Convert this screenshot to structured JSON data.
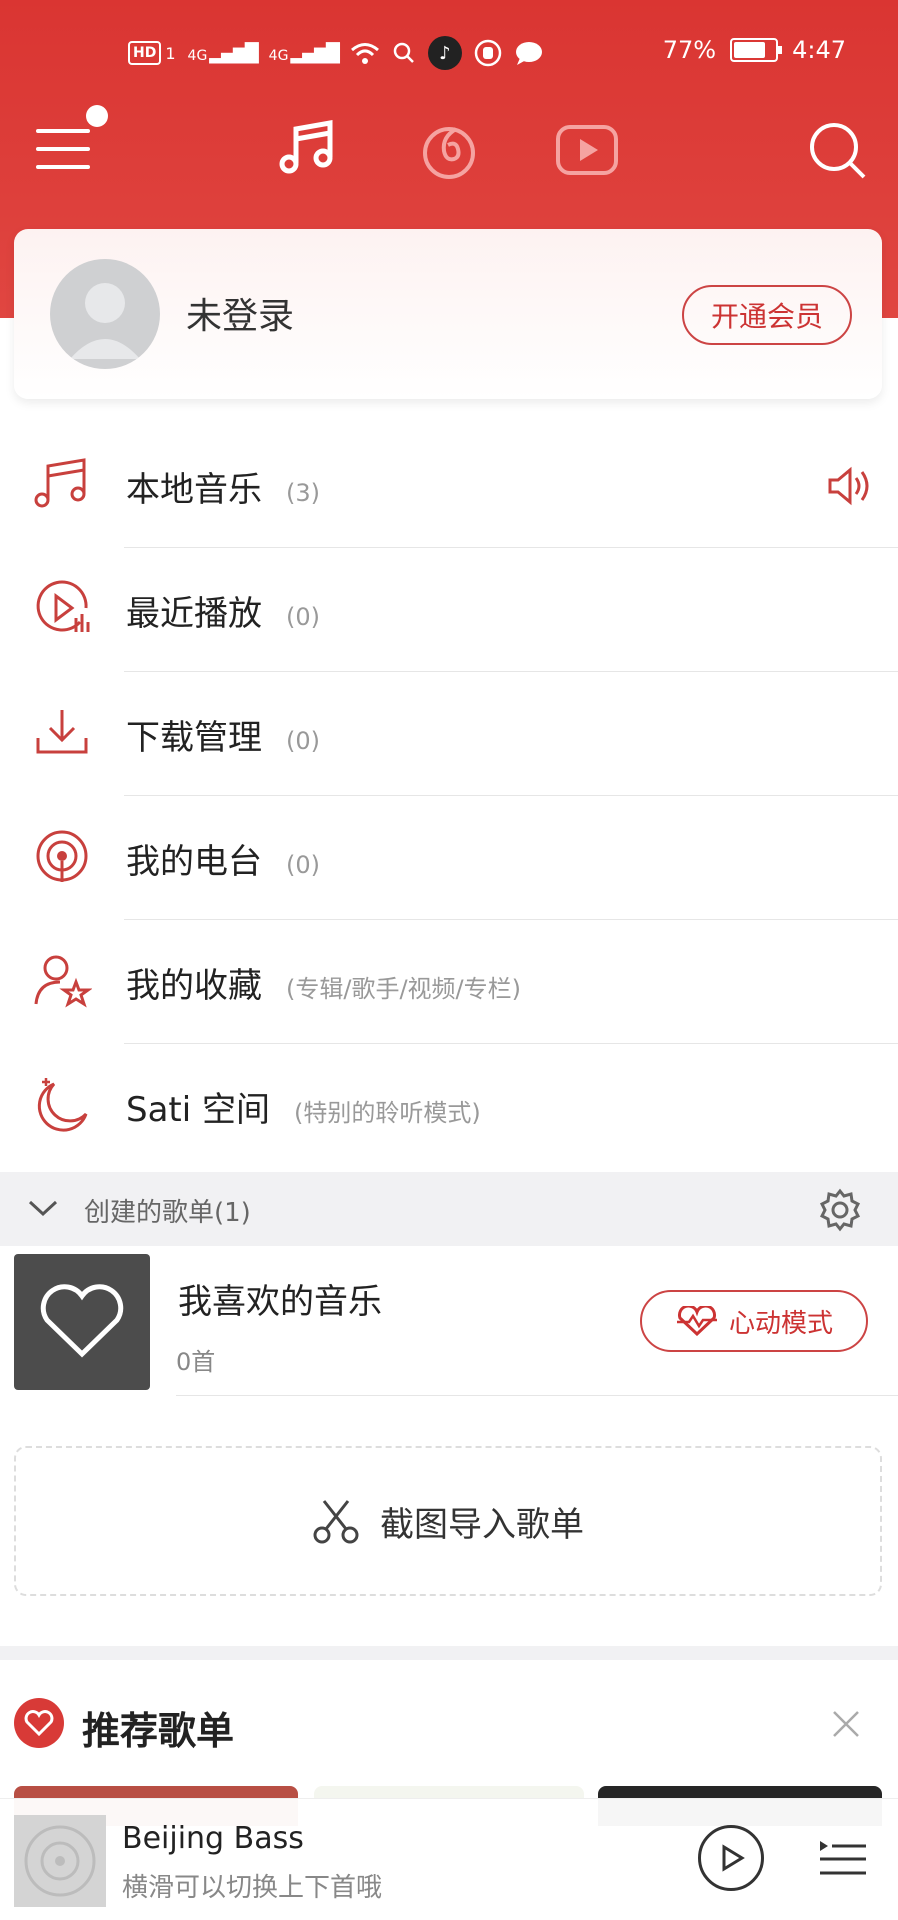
{
  "status_bar": {
    "left_badge": "HD",
    "left_badge_sub": "1",
    "network_1": "4G",
    "network_2": "4G",
    "battery_percent": "77%",
    "battery_level": 0.77,
    "time": "4:47"
  },
  "top_nav": {
    "menu_has_notification": true,
    "active_tab": "music-note-icon",
    "icons": [
      "menu-icon",
      "music-note-icon",
      "radio-loop-icon",
      "video-play-icon",
      "search-icon"
    ]
  },
  "profile_card": {
    "login_text": "未登录",
    "vip_button": "开通会员"
  },
  "menu_items": [
    {
      "label": "本地音乐",
      "count": "(3)",
      "icon": "music-note-icon"
    },
    {
      "label": "最近播放",
      "count": "(0)",
      "icon": "recent-play-icon"
    },
    {
      "label": "下载管理",
      "count": "(0)",
      "icon": "download-icon"
    },
    {
      "label": "我的电台",
      "count": "(0)",
      "icon": "radio-icon"
    },
    {
      "label": "我的收藏",
      "count": "(专辑/歌手/视频/专栏)",
      "icon": "favorite-user-icon"
    },
    {
      "label": "Sati 空间",
      "count": "(特别的聆听模式)",
      "icon": "moon-icon"
    }
  ],
  "section_header": {
    "title": "创建的歌单(1)"
  },
  "playlist": {
    "title": "我喜欢的音乐",
    "subtitle": "0首",
    "mode_button": "心动模式"
  },
  "import_button": "截图导入歌单",
  "recommend": {
    "title": "推荐歌单"
  },
  "mini_player": {
    "song": "Beijing Bass",
    "hint": "横滑可以切换上下首哦"
  },
  "colors": {
    "brand_red": "#da3532",
    "accent_red": "#c33"
  }
}
